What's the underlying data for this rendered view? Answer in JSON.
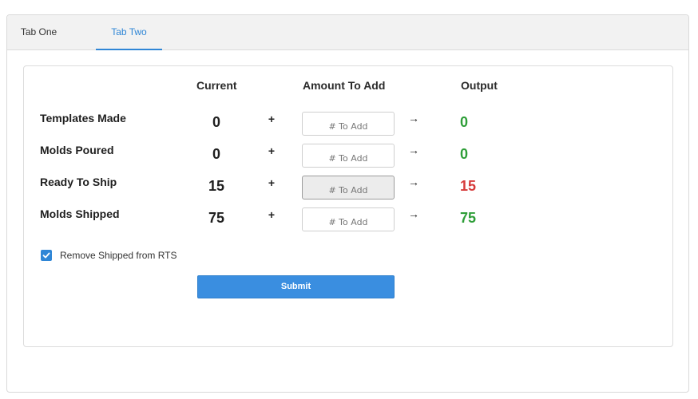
{
  "tabs": [
    {
      "label": "Tab One"
    },
    {
      "label": "Tab Two"
    }
  ],
  "headers": {
    "current": "Current",
    "amount": "Amount To Add",
    "output": "Output"
  },
  "rows": [
    {
      "label": "Templates Made",
      "current": "0",
      "plus": "+",
      "placeholder": "# To Add",
      "arrow": "→",
      "output": "0",
      "output_color": "#2e9e38",
      "disabled": false
    },
    {
      "label": "Molds Poured",
      "current": "0",
      "plus": "+",
      "placeholder": "# To Add",
      "arrow": "→",
      "output": "0",
      "output_color": "#2e9e38",
      "disabled": false
    },
    {
      "label": "Ready To Ship",
      "current": "15",
      "plus": "+",
      "placeholder": "# To Add",
      "arrow": "→",
      "output": "15",
      "output_color": "#d63b3b",
      "disabled": true
    },
    {
      "label": "Molds Shipped",
      "current": "75",
      "plus": "+",
      "placeholder": "# To Add",
      "arrow": "→",
      "output": "75",
      "output_color": "#2e9e38",
      "disabled": false
    }
  ],
  "checkbox": {
    "label": "Remove Shipped from RTS",
    "checked": true
  },
  "submit": {
    "label": "Submit"
  },
  "colors": {
    "accent": "#2f86d6",
    "button": "#3a8ee0",
    "positive": "#2e9e38",
    "negative": "#d63b3b"
  }
}
